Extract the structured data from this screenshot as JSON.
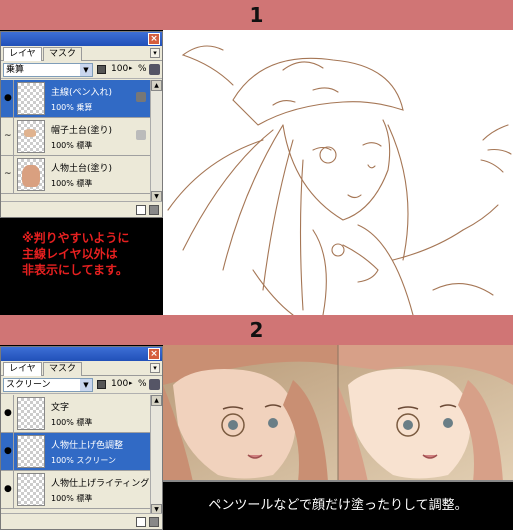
{
  "steps": {
    "step1": "1",
    "step2": "2"
  },
  "panel1": {
    "tabs": [
      "レイヤ",
      "マスク"
    ],
    "blend_mode": "乗算",
    "opacity": "100",
    "opacity_unit": "%",
    "layers": [
      {
        "name": "主線(ペン入れ)",
        "mode": "100% 乗算"
      },
      {
        "name": "帽子土台(塗り)",
        "mode": "100% 標準"
      },
      {
        "name": "人物土台(塗り)",
        "mode": "100% 標準"
      }
    ]
  },
  "note": {
    "line1": "※判りやすいように",
    "line2": "主線レイヤ以外は",
    "line3": "非表示にしてます。"
  },
  "panel2": {
    "tabs": [
      "レイヤ",
      "マスク"
    ],
    "blend_mode": "スクリーン",
    "opacity": "100",
    "opacity_unit": "%",
    "layers": [
      {
        "name": "文字",
        "mode": "100% 標準"
      },
      {
        "name": "人物仕上げ色調整",
        "mode": "100% スクリーン"
      },
      {
        "name": "人物仕上げライティング...",
        "mode": "100% 標準"
      }
    ]
  },
  "caption": "ペンツールなどで顔だけ塗ったりして調整。",
  "colors": {
    "bar": "#d07575",
    "note_text": "#e62020",
    "selected": "#316ac5"
  }
}
